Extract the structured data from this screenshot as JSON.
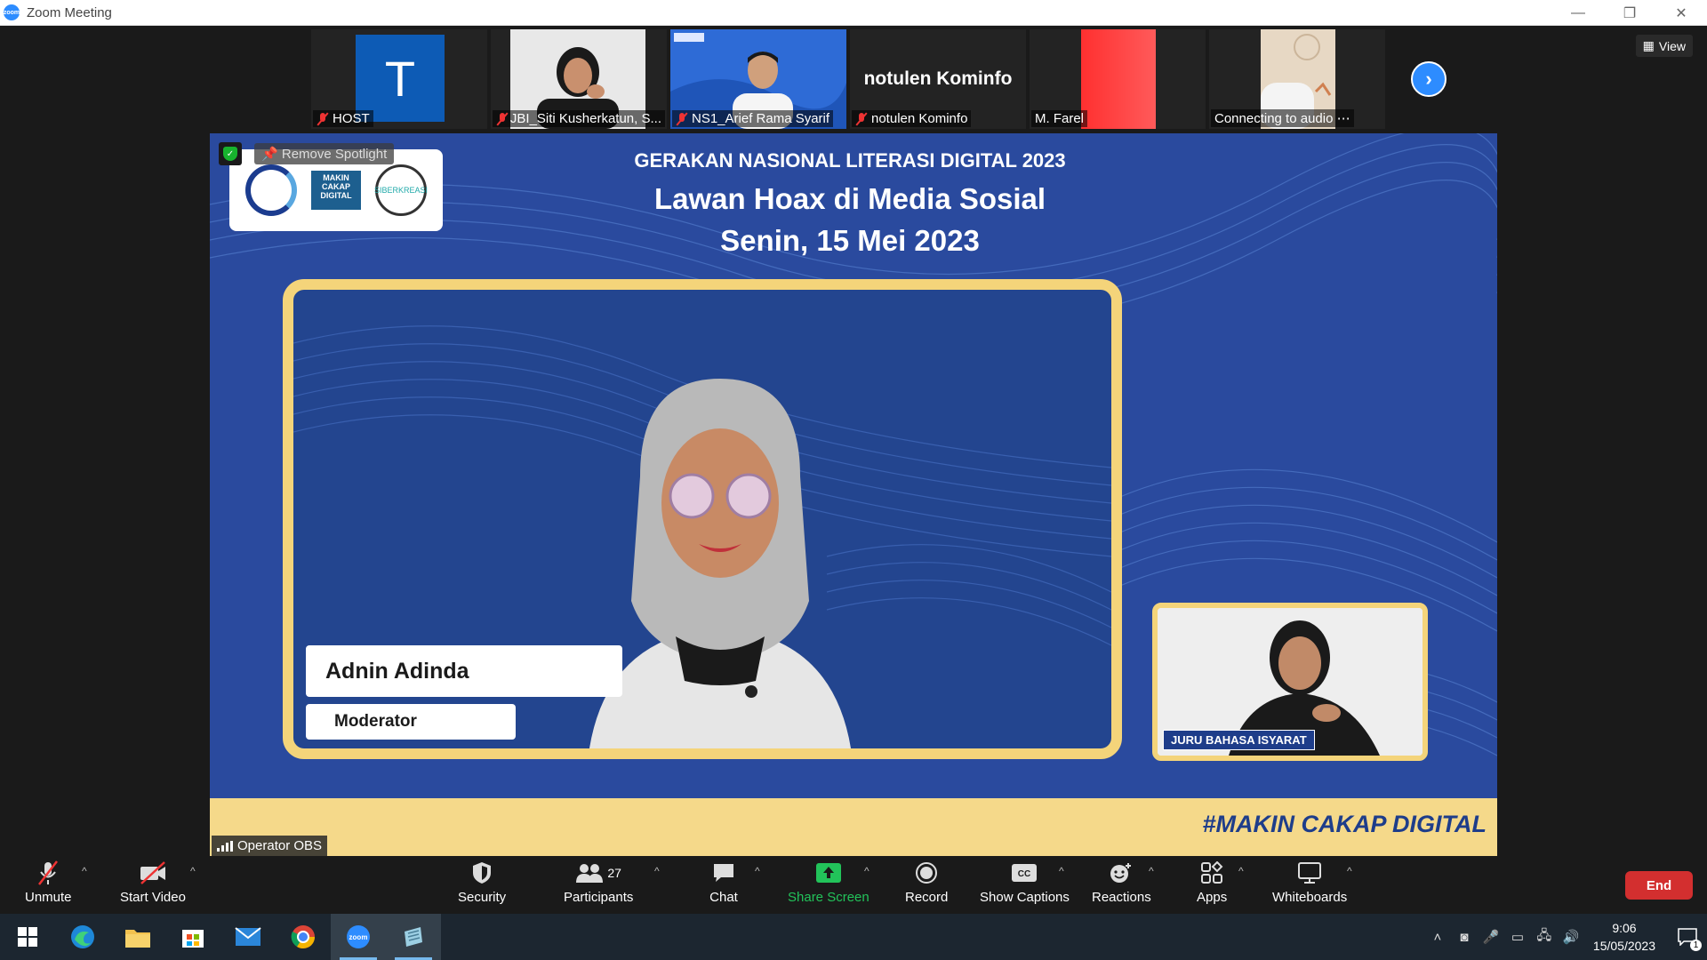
{
  "window": {
    "title": "Zoom Meeting",
    "controls": [
      "—",
      "❐",
      "✕"
    ]
  },
  "thumbnails": [
    {
      "name": "HOST",
      "muted": true,
      "avatar_letter": "T"
    },
    {
      "name": "JBI_Siti Kusherkatun, S...",
      "muted": true
    },
    {
      "name": "NS1_Arief Rama Syarif",
      "muted": true
    },
    {
      "name": "notulen Kominfo",
      "muted": true,
      "big_label": "notulen Kominfo"
    },
    {
      "name": "M. Farel",
      "muted": false
    },
    {
      "name": "Connecting to audio ⋯",
      "muted": false
    }
  ],
  "view_button": "View",
  "main": {
    "spotlight_button": "Remove Spotlight",
    "logos": {
      "kominfo": "KOMINFO",
      "makin": "MAKIN CAKAP DIGITAL",
      "siber": "SIBERKREASI"
    },
    "header_line1": "GERAKAN NASIONAL LITERASI DIGITAL 2023",
    "header_line2": "Lawan Hoax di Media Sosial",
    "header_line3": "Senin, 15 Mei 2023",
    "speaker_name": "Adnin Adinda",
    "speaker_role": "Moderator",
    "interpreter_label": "JURU BAHASA ISYARAT",
    "hashtag": "#MAKIN CAKAP DIGITAL",
    "operator_label": "Operator OBS"
  },
  "toolbar": {
    "unmute": "Unmute",
    "start_video": "Start Video",
    "security": "Security",
    "participants": "Participants",
    "participants_count": "27",
    "chat": "Chat",
    "share_screen": "Share Screen",
    "record": "Record",
    "show_captions": "Show Captions",
    "reactions": "Reactions",
    "apps": "Apps",
    "whiteboards": "Whiteboards",
    "end": "End"
  },
  "taskbar": {
    "time": "9:06",
    "date": "15/05/2023",
    "notification_count": "1"
  },
  "colors": {
    "zoom_blue": "#2d8cff",
    "share_green": "#22c35a",
    "end_red": "#d32f2f",
    "frame_gold": "#f4d47a",
    "stage_blue": "#2a4a9e"
  }
}
